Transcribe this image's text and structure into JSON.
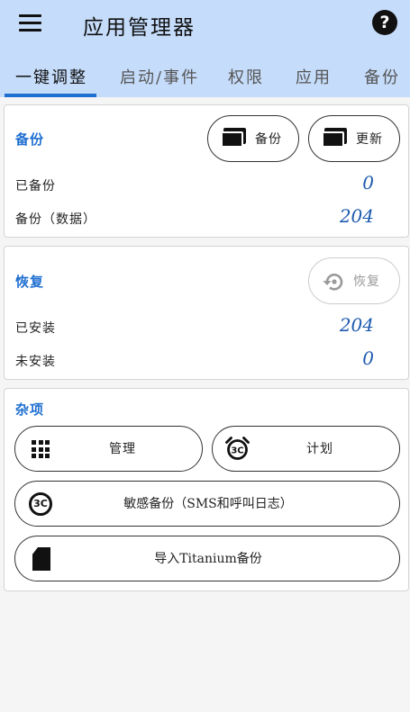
{
  "appbar": {
    "title": "应用管理器",
    "menu_icon": "hamburger-menu-icon",
    "help_icon": "help-icon",
    "help_glyph": "?"
  },
  "tabs": [
    {
      "label": "一键调整",
      "active": true
    },
    {
      "label": "启动/事件",
      "active": false
    },
    {
      "label": "权限",
      "active": false
    },
    {
      "label": "应用",
      "active": false
    },
    {
      "label": "备份",
      "active": false
    }
  ],
  "backup_card": {
    "title": "备份",
    "backup_button": "备份",
    "update_button": "更新",
    "rows": [
      {
        "label": "已备份",
        "value": "0"
      },
      {
        "label": "备份（数据）",
        "value": "204"
      }
    ]
  },
  "restore_card": {
    "title": "恢复",
    "restore_button": "恢复",
    "rows": [
      {
        "label": "已安装",
        "value": "204"
      },
      {
        "label": "未安装",
        "value": "0"
      }
    ]
  },
  "misc_card": {
    "title": "杂项",
    "manage_button": "管理",
    "schedule_button": "计划",
    "sensitive_backup_button": "敏感备份（SMS和呼叫日志）",
    "import_titanium_button": "导入Titanium备份",
    "cc_glyph": "3C"
  },
  "colors": {
    "appbar": "#c5dcfa",
    "accent": "#1f6fd1",
    "value": "#1f5bb0"
  }
}
